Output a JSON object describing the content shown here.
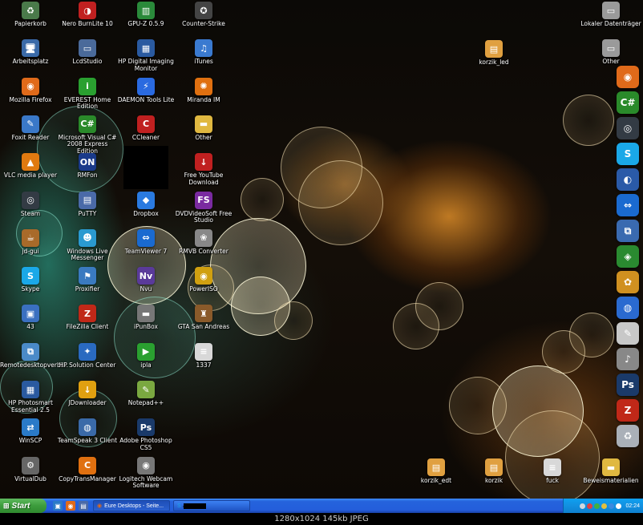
{
  "desktop": {
    "icons_col1": [
      {
        "label": "Papierkorb",
        "icon": "recycle-bin-icon",
        "glyph": "♻",
        "color": "#4a7a4a"
      },
      {
        "label": "Arbeitsplatz",
        "icon": "computer-icon",
        "glyph": "🖥",
        "color": "#3a6aa8"
      },
      {
        "label": "Mozilla Firefox",
        "icon": "firefox-icon",
        "glyph": "◉",
        "color": "#e06a1a"
      },
      {
        "label": "Foxit Reader",
        "icon": "foxit-reader-icon",
        "glyph": "✎",
        "color": "#3a78c8"
      },
      {
        "label": "VLC media player",
        "icon": "vlc-icon",
        "glyph": "▲",
        "color": "#e07a10"
      },
      {
        "label": "Steam",
        "icon": "steam-icon",
        "glyph": "◎",
        "color": "#333b44"
      },
      {
        "label": "jd-gui",
        "icon": "coffee-cup-icon",
        "glyph": "☕",
        "color": "#a86a2a"
      },
      {
        "label": "Skype",
        "icon": "skype-icon",
        "glyph": "S",
        "color": "#1aa8e8"
      },
      {
        "label": "43",
        "icon": "folder-blue-icon",
        "glyph": "▣",
        "color": "#3a70c0"
      },
      {
        "label": "Remotedesktopverbi...",
        "icon": "remote-desktop-icon",
        "glyph": "⧉",
        "color": "#4a8ac8"
      },
      {
        "label": "HP Photosmart Essential 2.5",
        "icon": "hp-photosmart-icon",
        "glyph": "▦",
        "color": "#2a5aa0"
      },
      {
        "label": "WinSCP",
        "icon": "winscp-icon",
        "glyph": "⇄",
        "color": "#2a7ac8"
      },
      {
        "label": "VirtualDub",
        "icon": "virtualdub-icon",
        "glyph": "⚙",
        "color": "#666666"
      }
    ],
    "icons_col2": [
      {
        "label": "Nero BurnLite 10",
        "icon": "nero-icon",
        "glyph": "◑",
        "color": "#c02020"
      },
      {
        "label": "LcdStudio",
        "icon": "lcd-studio-icon",
        "glyph": "▭",
        "color": "#4a6a9a"
      },
      {
        "label": "EVEREST Home Edition",
        "icon": "everest-icon",
        "glyph": "i",
        "color": "#2aa030"
      },
      {
        "label": "Microsoft Visual C# 2008 Express Edition",
        "icon": "visual-csharp-icon",
        "glyph": "C#",
        "color": "#2a8a2a"
      },
      {
        "label": "RMFon",
        "icon": "rmfon-icon",
        "glyph": "ON",
        "color": "#1a3a8a"
      },
      {
        "label": "PuTTY",
        "icon": "putty-icon",
        "glyph": "▤",
        "color": "#4a6aa8"
      },
      {
        "label": "Windows Live Messenger",
        "icon": "messenger-icon",
        "glyph": "☻",
        "color": "#2a9ad0"
      },
      {
        "label": "Proxifier",
        "icon": "proxifier-icon",
        "glyph": "⚑",
        "color": "#3a7ac0"
      },
      {
        "label": "FileZilla Client",
        "icon": "filezilla-icon",
        "glyph": "Z",
        "color": "#c02818"
      },
      {
        "label": "HP Solution Center",
        "icon": "hp-solution-icon",
        "glyph": "✦",
        "color": "#2a6ac0"
      },
      {
        "label": "JDownloader",
        "icon": "jdownloader-icon",
        "glyph": "↓",
        "color": "#e0a010"
      },
      {
        "label": "TeamSpeak 3 Client",
        "icon": "teamspeak-icon",
        "glyph": "◍",
        "color": "#3a6aa8"
      },
      {
        "label": "CopyTransManager",
        "icon": "copytrans-icon",
        "glyph": "C",
        "color": "#e07010"
      }
    ],
    "icons_col3": [
      {
        "label": "GPU-Z 0.5.9",
        "icon": "gpu-z-icon",
        "glyph": "▥",
        "color": "#2a8a3a"
      },
      {
        "label": "HP Digital Imaging Monitor",
        "icon": "hp-imaging-icon",
        "glyph": "▦",
        "color": "#2a5aa0"
      },
      {
        "label": "DAEMON Tools Lite",
        "icon": "daemon-tools-icon",
        "glyph": "⚡",
        "color": "#2a6ae0"
      },
      {
        "label": "CCleaner",
        "icon": "ccleaner-icon",
        "glyph": "C",
        "color": "#c02020"
      },
      {
        "label": "Dropbox",
        "icon": "dropbox-icon",
        "glyph": "◆",
        "color": "#2a7ae0"
      },
      {
        "label": "TeamViewer 7",
        "icon": "teamviewer-icon",
        "glyph": "⇔",
        "color": "#1a6ad0"
      },
      {
        "label": "Nvu",
        "icon": "nvu-icon",
        "glyph": "Nv",
        "color": "#5a3a9a"
      },
      {
        "label": "iPunBox",
        "icon": "ipunbox-icon",
        "glyph": "▬",
        "color": "#777777"
      },
      {
        "label": "ipla",
        "icon": "ipla-icon",
        "glyph": "▶",
        "color": "#2aa030"
      },
      {
        "label": "Notepad++",
        "icon": "notepadpp-icon",
        "glyph": "✎",
        "color": "#7aa840"
      },
      {
        "label": "Adobe Photoshop CS5",
        "icon": "photoshop-icon",
        "glyph": "Ps",
        "color": "#1a3a6a"
      },
      {
        "label": "Logitech Webcam Software",
        "icon": "webcam-icon",
        "glyph": "◉",
        "color": "#777777"
      }
    ],
    "icons_col4": [
      {
        "label": "Counter-Strike",
        "icon": "counter-strike-icon",
        "glyph": "✪",
        "color": "#444444"
      },
      {
        "label": "iTunes",
        "icon": "itunes-icon",
        "glyph": "♫",
        "color": "#3a7ad0"
      },
      {
        "label": "Miranda IM",
        "icon": "miranda-icon",
        "glyph": "✺",
        "color": "#e07010"
      },
      {
        "label": "Other",
        "icon": "folder-icon",
        "glyph": "▬",
        "color": "#e0b840"
      },
      {
        "label": "Free YouTube Download",
        "icon": "youtube-download-icon",
        "glyph": "↓",
        "color": "#c02020"
      },
      {
        "label": "DVDVideoSoft Free Studio",
        "icon": "dvdvideosoft-icon",
        "glyph": "FS",
        "color": "#7a2aa0"
      },
      {
        "label": "RMVB Converter",
        "icon": "rmvb-converter-icon",
        "glyph": "❀",
        "color": "#888888"
      },
      {
        "label": "PowerISO",
        "icon": "poweriso-icon",
        "glyph": "◉",
        "color": "#d0a010"
      },
      {
        "label": "GTA San Andreas",
        "icon": "gta-icon",
        "glyph": "♜",
        "color": "#8a5a2a"
      },
      {
        "label": "1337",
        "icon": "text-file-icon",
        "glyph": "≡",
        "color": "#d8d8d8"
      }
    ],
    "top_right": [
      {
        "label": "Lokaler Datenträger",
        "icon": "drive-icon",
        "glyph": "▭",
        "color": "#9a9a9a"
      },
      {
        "label": "Other",
        "icon": "drive-icon",
        "glyph": "▭",
        "color": "#9a9a9a"
      }
    ],
    "korzik_icon": {
      "label": "korzik_led",
      "icon": "image-file-icon",
      "glyph": "▤",
      "color": "#e0a040"
    },
    "bottom_files": [
      {
        "label": "korzik_edt",
        "icon": "image-file-icon",
        "glyph": "▤",
        "color": "#e0a040"
      },
      {
        "label": "korzik",
        "icon": "image-file-icon",
        "glyph": "▤",
        "color": "#e0a040"
      },
      {
        "label": "fuck",
        "icon": "text-file-icon",
        "glyph": "≡",
        "color": "#d8d8d8"
      },
      {
        "label": "Beweismaterialien",
        "icon": "folder-icon",
        "glyph": "▬",
        "color": "#e0b840"
      }
    ]
  },
  "dock": [
    {
      "icon": "firefox-icon",
      "glyph": "◉",
      "color": "#e06a1a"
    },
    {
      "icon": "visual-csharp-icon",
      "glyph": "C#",
      "color": "#2a8a2a"
    },
    {
      "icon": "steam-icon",
      "glyph": "◎",
      "color": "#333b44"
    },
    {
      "icon": "skype-icon",
      "glyph": "S",
      "color": "#1aa8e8"
    },
    {
      "icon": "miranda-icon",
      "glyph": "◐",
      "color": "#2a5aa8"
    },
    {
      "icon": "teamviewer-icon",
      "glyph": "⇔",
      "color": "#1a6ad0"
    },
    {
      "icon": "network-icon",
      "glyph": "⧉",
      "color": "#3a6ab0"
    },
    {
      "icon": "jdownloader-icon",
      "glyph": "◈",
      "color": "#2a8a30"
    },
    {
      "icon": "gift-icon",
      "glyph": "✿",
      "color": "#d09020"
    },
    {
      "icon": "globe-icon",
      "glyph": "◍",
      "color": "#2a6ad0"
    },
    {
      "icon": "notepad-icon",
      "glyph": "✎",
      "color": "#c8c8c8"
    },
    {
      "icon": "speaker-icon",
      "glyph": "♪",
      "color": "#888888"
    },
    {
      "icon": "photoshop-icon",
      "glyph": "Ps",
      "color": "#1a3a6a"
    },
    {
      "icon": "filezilla-icon",
      "glyph": "Z",
      "color": "#c02818"
    },
    {
      "icon": "recycle-bin-icon",
      "glyph": "♻",
      "color": "#aab0b8"
    }
  ],
  "taskbar": {
    "start_label": "Start",
    "tasks": [
      {
        "label": "Eure Desktops - Seite..."
      },
      {
        "label": "▬▬▬▬"
      }
    ],
    "clock": "02:24"
  },
  "caption": "1280x1024  145kb  JPEG"
}
